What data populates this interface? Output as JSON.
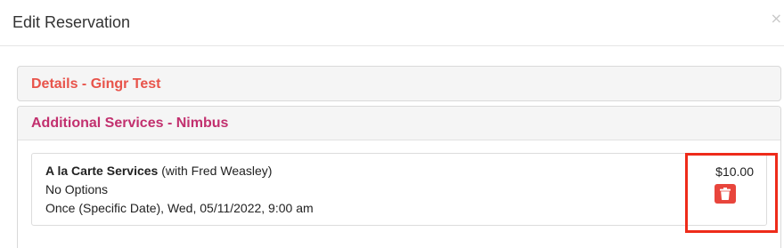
{
  "modal": {
    "title": "Edit Reservation",
    "close_label": "×"
  },
  "details_panel": {
    "heading": "Details - Gingr Test",
    "color": "#e8534a"
  },
  "services_panel": {
    "heading": "Additional Services - Nimbus",
    "color": "#c2306e",
    "service": {
      "name": "A la Carte Services",
      "staff": " (with Fred Weasley)",
      "options": "No Options",
      "schedule": "Once (Specific Date), Wed, 05/11/2022, 9:00 am",
      "price": "$10.00",
      "delete_icon": "trash-icon",
      "delete_color": "#e8453c"
    }
  },
  "highlight": {
    "color": "#ee2b1a"
  }
}
